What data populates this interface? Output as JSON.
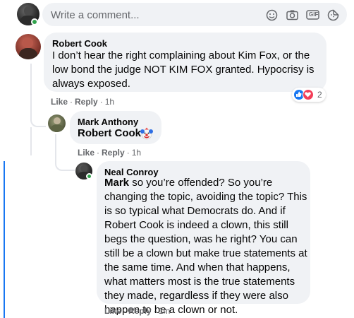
{
  "composer": {
    "placeholder": "Write a comment...",
    "icons": [
      "emoji-icon",
      "camera-icon",
      "gif-icon",
      "sticker-icon"
    ],
    "gif_label": "GIF"
  },
  "comments": [
    {
      "author": "Robert Cook",
      "text": "I don’t hear the right complaining about Kim Fox, or the low bond the judge NOT KIM FOX granted. Hypocrisy is always exposed.",
      "actions": {
        "like": "Like",
        "reply": "Reply",
        "time": "1h"
      },
      "reactions": {
        "count": "2",
        "types": [
          "like",
          "love"
        ]
      }
    },
    {
      "author": "Mark Anthony",
      "mention": "Robert Cook",
      "emoji": "clown-face",
      "actions": {
        "like": "Like",
        "reply": "Reply",
        "time": "1h"
      }
    },
    {
      "author": "Neal Conroy",
      "mention": "Mark",
      "text": " so you’re offended? So you’re changing the topic, avoiding the topic? This is so typical what Democrats do. And if Robert Cook is indeed a clown, this still begs the question, was he right? You can still be a clown but make true statements at the same time. And when that happens, what matters most is the true statements they made, regardless if they were also happen to be a clown or not.",
      "actions": {
        "like": "Like",
        "reply": "Reply",
        "time": "1m"
      }
    }
  ],
  "colors": {
    "bubble": "#f0f2f5",
    "secondary_text": "#65676b",
    "online": "#31a24c",
    "like_blue": "#1877f2",
    "love_red": "#f33e58",
    "focus_line": "#1877f2"
  }
}
